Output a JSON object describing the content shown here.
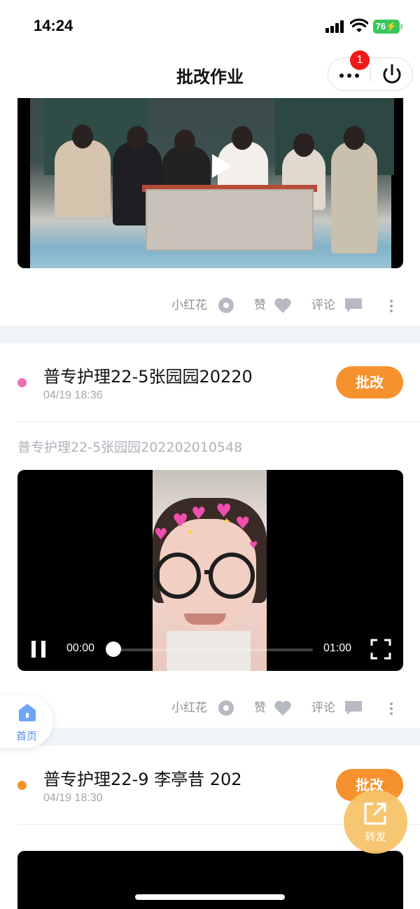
{
  "status_bar": {
    "time": "14:24",
    "battery": "76"
  },
  "nav": {
    "title": "批改作业",
    "notification_count": "1"
  },
  "actions": {
    "flower": "小红花",
    "like": "赞",
    "comment": "评论"
  },
  "posts": [
    {
      "name": "普专护理22-5张园园20220",
      "time": "04/19 18:36",
      "grade_label": "批改",
      "dot_color": "#ef6fb0",
      "caption": "普专护理22-5张园园202202010548",
      "video": {
        "current": "00:00",
        "duration": "01:00",
        "state": "playing",
        "progress": 0
      }
    },
    {
      "name": "普专护理22-9 李亭昔 202",
      "time": "04/19 18:30",
      "grade_label": "批改",
      "dot_color": "#f5922e"
    }
  ],
  "tabbar": {
    "home": "首页"
  },
  "fab": {
    "share": "转发"
  },
  "colors": {
    "accent": "#f5922e",
    "link": "#4a8ef0",
    "badge": "#f01a1a",
    "battery": "#38c75a"
  }
}
